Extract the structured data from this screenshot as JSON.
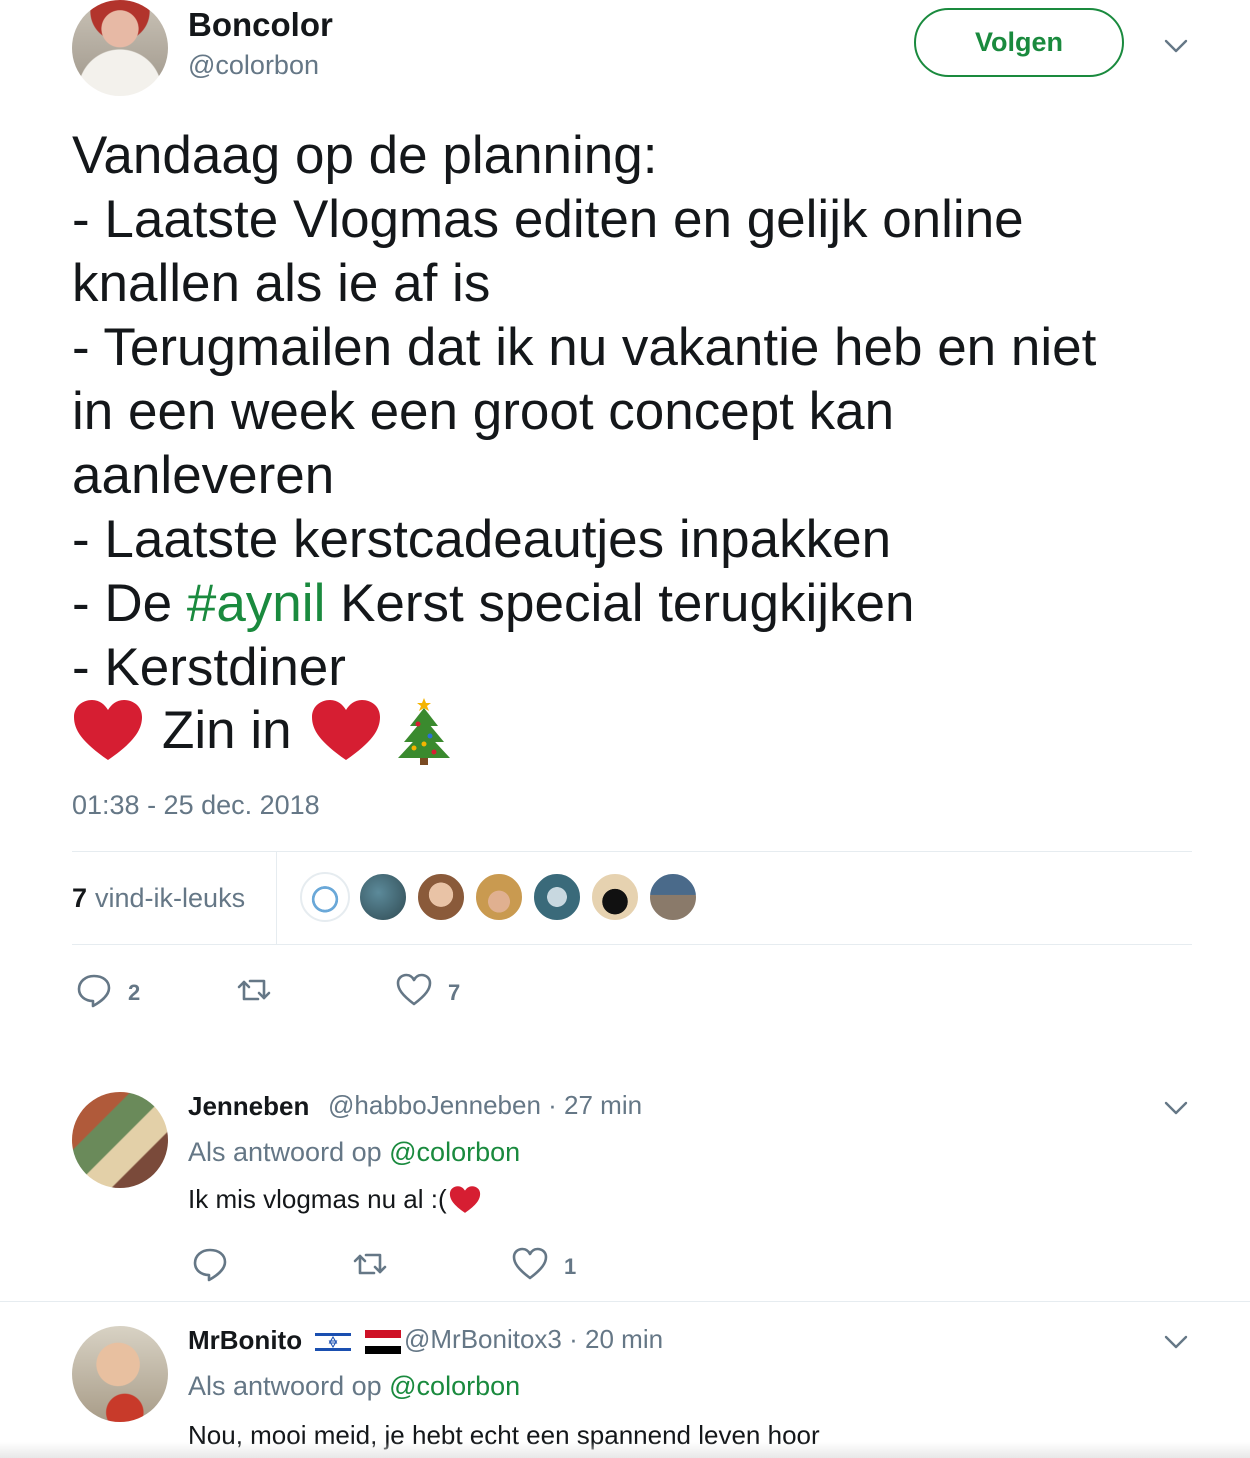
{
  "tweet": {
    "author": {
      "display_name": "Boncolor",
      "handle": "@colorbon"
    },
    "follow_label": "Volgen",
    "lines": [
      "Vandaag op de planning:",
      "- Laatste Vlogmas editen en gelijk online",
      "knallen als ie af is",
      "- Terugmailen dat ik nu vakantie heb en niet",
      "in een week een groot concept kan",
      "aanleveren",
      "- Laatste kerstcadeautjes inpakken"
    ],
    "hashtag_line": {
      "prefix": "- De ",
      "hashtag": "#aynil",
      "suffix": " Kerst special terugkijken"
    },
    "last_line": "- Kerstdiner",
    "emoji_text": "Zin in",
    "timestamp": "01:38 - 25 dec. 2018",
    "likes_count": "7",
    "likes_label": "vind-ik-leuks",
    "actions": {
      "replies": "2",
      "retweets": "",
      "likes": "7"
    }
  },
  "replies": [
    {
      "display_name": "Jenneben",
      "handle": "@habboJenneben",
      "time": "· 27 min",
      "reply_prefix": "Als antwoord op",
      "mention": "@colorbon",
      "text": "Ik mis vlogmas nu al :(",
      "actions": {
        "replies": "",
        "retweets": "",
        "likes": "1"
      }
    },
    {
      "display_name": "MrBonito",
      "handle": "@MrBonitox3",
      "time": "· 20 min",
      "reply_prefix": "Als antwoord op",
      "mention": "@colorbon",
      "text": "Nou, mooi meid, je hebt echt een spannend leven hoor"
    }
  ],
  "colors": {
    "accent": "#1a8a3e",
    "secondary_text": "#657786",
    "primary_text": "#14171a",
    "heart": "#d61e32"
  },
  "icons": [
    "chevron-down-icon",
    "reply-icon",
    "retweet-icon",
    "like-icon",
    "heart-emoji-icon",
    "christmas-tree-icon",
    "flag-israel-icon",
    "flag-egypt-icon"
  ]
}
